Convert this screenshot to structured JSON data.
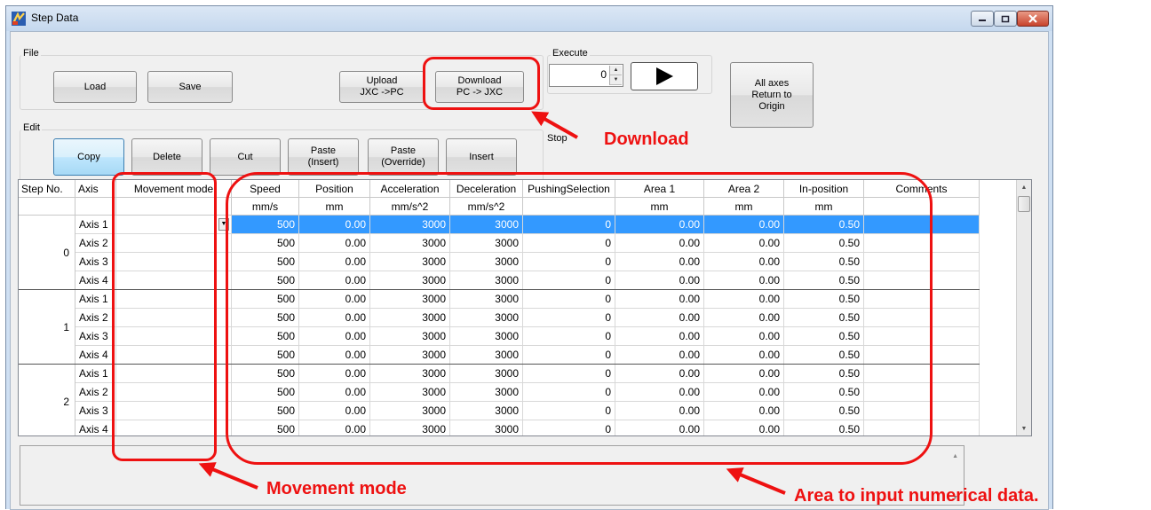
{
  "window": {
    "title": "Step Data"
  },
  "file_group": {
    "label": "File",
    "load": "Load",
    "save": "Save",
    "upload": "Upload\nJXC ->PC",
    "download": "Download\nPC -> JXC"
  },
  "execute_group": {
    "label": "Execute",
    "step_value": "0",
    "stop_label": "Stop"
  },
  "return_origin": "All axes\nReturn to\nOrigin",
  "edit_group": {
    "label": "Edit",
    "copy": "Copy",
    "delete": "Delete",
    "cut": "Cut",
    "paste_insert": "Paste\n(Insert)",
    "paste_override": "Paste\n(Override)",
    "insert": "Insert"
  },
  "grid": {
    "headers": [
      "Step No.",
      "Axis",
      "Movement mode",
      "Speed",
      "Position",
      "Acceleration",
      "Deceleration",
      "PushingSelection",
      "Area 1",
      "Area 2",
      "In-position",
      "Comments"
    ],
    "units": [
      "",
      "",
      "",
      "mm/s",
      "mm",
      "mm/s^2",
      "mm/s^2",
      "",
      "mm",
      "mm",
      "mm",
      ""
    ],
    "steps": [
      {
        "step": "0",
        "rows": [
          [
            "Axis 1",
            "",
            "500",
            "0.00",
            "3000",
            "3000",
            "0",
            "0.00",
            "0.00",
            "0.50",
            ""
          ],
          [
            "Axis 2",
            "",
            "500",
            "0.00",
            "3000",
            "3000",
            "0",
            "0.00",
            "0.00",
            "0.50",
            ""
          ],
          [
            "Axis 3",
            "",
            "500",
            "0.00",
            "3000",
            "3000",
            "0",
            "0.00",
            "0.00",
            "0.50",
            ""
          ],
          [
            "Axis 4",
            "",
            "500",
            "0.00",
            "3000",
            "3000",
            "0",
            "0.00",
            "0.00",
            "0.50",
            ""
          ]
        ]
      },
      {
        "step": "1",
        "rows": [
          [
            "Axis 1",
            "",
            "500",
            "0.00",
            "3000",
            "3000",
            "0",
            "0.00",
            "0.00",
            "0.50",
            ""
          ],
          [
            "Axis 2",
            "",
            "500",
            "0.00",
            "3000",
            "3000",
            "0",
            "0.00",
            "0.00",
            "0.50",
            ""
          ],
          [
            "Axis 3",
            "",
            "500",
            "0.00",
            "3000",
            "3000",
            "0",
            "0.00",
            "0.00",
            "0.50",
            ""
          ],
          [
            "Axis 4",
            "",
            "500",
            "0.00",
            "3000",
            "3000",
            "0",
            "0.00",
            "0.00",
            "0.50",
            ""
          ]
        ]
      },
      {
        "step": "2",
        "rows": [
          [
            "Axis 1",
            "",
            "500",
            "0.00",
            "3000",
            "3000",
            "0",
            "0.00",
            "0.00",
            "0.50",
            ""
          ],
          [
            "Axis 2",
            "",
            "500",
            "0.00",
            "3000",
            "3000",
            "0",
            "0.00",
            "0.00",
            "0.50",
            ""
          ],
          [
            "Axis 3",
            "",
            "500",
            "0.00",
            "3000",
            "3000",
            "0",
            "0.00",
            "0.00",
            "0.50",
            ""
          ],
          [
            "Axis 4",
            "",
            "500",
            "0.00",
            "3000",
            "3000",
            "0",
            "0.00",
            "0.00",
            "0.50",
            ""
          ]
        ]
      }
    ]
  },
  "annotations": {
    "download": "Download",
    "movement_mode": "Movement mode",
    "area": "Area to input numerical data."
  },
  "colors": {
    "annotation_red": "#ee1111",
    "selection_blue": "#3399ff"
  },
  "icons": {
    "app": "step-data-app-icon",
    "execute": "play-triangle-icon",
    "minimize": "minimize-icon",
    "maximize": "maximize-icon",
    "close": "close-icon",
    "dropdown": "chevron-down-icon"
  }
}
